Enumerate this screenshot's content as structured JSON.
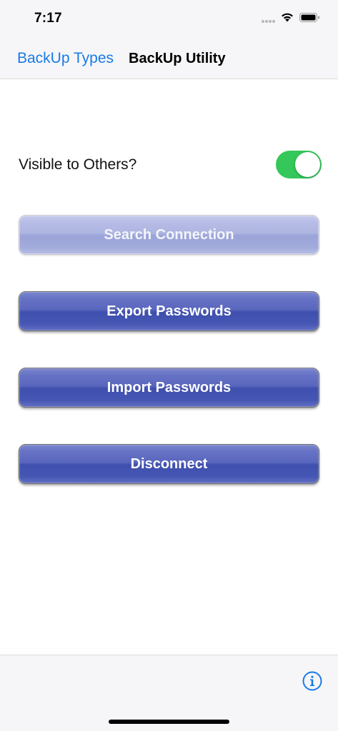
{
  "status_bar": {
    "time": "7:17"
  },
  "nav_bar": {
    "back_label": "BackUp Types",
    "title": "BackUp Utility"
  },
  "settings": {
    "visible_label": "Visible to Others?",
    "visible_on": true
  },
  "buttons": {
    "search_label": "Search Connection",
    "export_label": "Export Passwords",
    "import_label": "Import Passwords",
    "disconnect_label": "Disconnect"
  },
  "icons": {
    "wifi": "wifi-icon",
    "battery": "battery-icon",
    "info": "info-icon"
  },
  "colors": {
    "accent": "#1a7ae6",
    "toggle_on": "#34c759",
    "button_blue": "#4556b3"
  }
}
